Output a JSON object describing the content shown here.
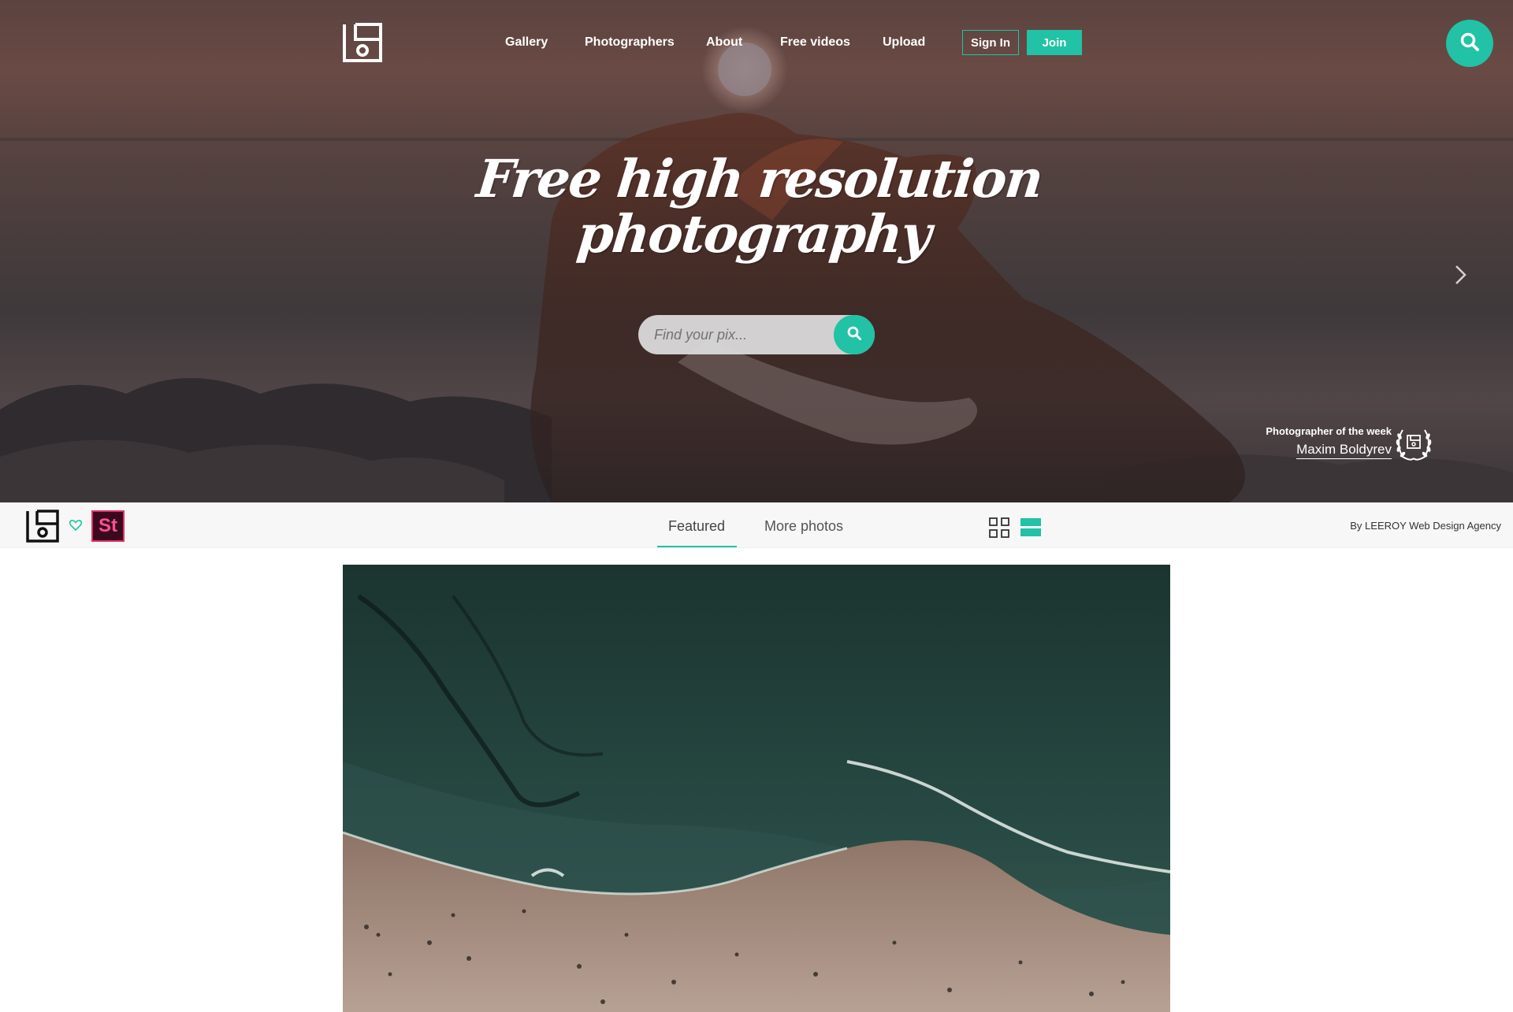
{
  "brand": {
    "logo_icon": "stocksnap-logo-icon",
    "accent_color": "#21c2a6"
  },
  "nav": {
    "items": [
      {
        "label": "Gallery"
      },
      {
        "label": "Photographers"
      },
      {
        "label": "About"
      },
      {
        "label": "Free videos"
      },
      {
        "label": "Upload"
      }
    ],
    "sign_in": "Sign In",
    "join": "Join",
    "search_icon": "search-icon"
  },
  "hero": {
    "headline_line1": "Free high resolution",
    "headline_line2": "photography",
    "search": {
      "placeholder": "Find your pix...",
      "button_icon": "search-icon"
    },
    "next_icon": "chevron-right-icon",
    "photographer_of_week": {
      "label": "Photographer of the week",
      "name": "Maxim Boldyrev",
      "icon": "laurel-badge-icon"
    }
  },
  "subbar": {
    "stock_badge": "St",
    "tabs": [
      {
        "label": "Featured",
        "active": true
      },
      {
        "label": "More photos",
        "active": false
      }
    ],
    "view_icons": [
      "grid-view-icon",
      "list-view-icon"
    ],
    "credit": "By LEEROY Web Design Agency"
  }
}
